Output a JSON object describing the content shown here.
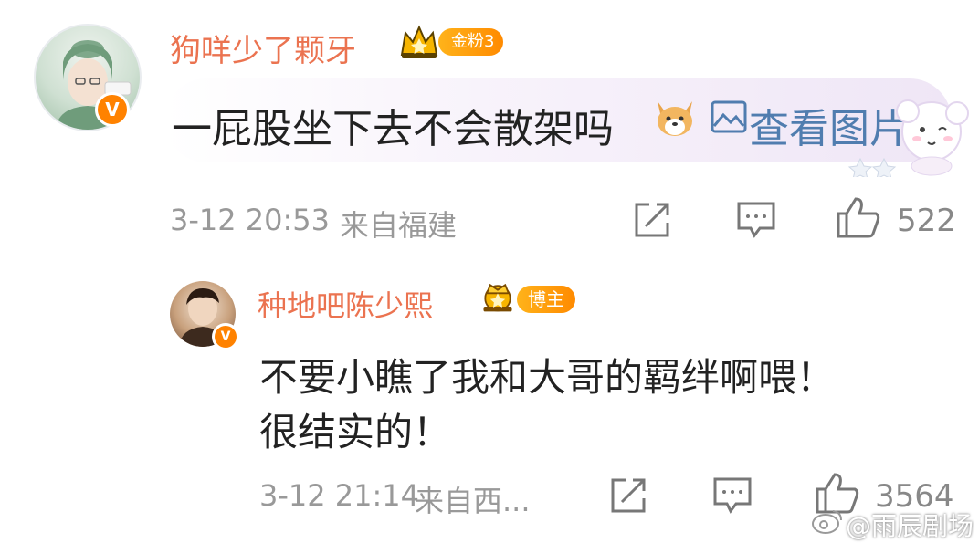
{
  "comment": {
    "username": "狗咩少了颗牙",
    "fan_badge": "金粉3",
    "text": "一屁股坐下去不会散架吗",
    "view_image_label": "查看图片",
    "timestamp": "3-12 20:53",
    "location": "来自福建",
    "like_count": "522"
  },
  "reply": {
    "username": "种地吧陈少熙",
    "role_badge": "博主",
    "text_line1": "不要小瞧了我和大哥的羁绊啊喂！",
    "text_line2": "很结实的！",
    "timestamp": "3-12 21:14",
    "location": "来自西...",
    "like_count": "3564"
  },
  "watermark": "@雨辰剧场",
  "colors": {
    "username": "#eb7350",
    "link": "#507daf",
    "badge": "#ff8a00",
    "verified": "#ff8200"
  },
  "icons": [
    "verified-icon",
    "crown-icon",
    "dog-emoji-icon",
    "image-icon",
    "share-icon",
    "comment-icon",
    "like-icon",
    "bear-sticker-icon",
    "weibo-logo-icon"
  ]
}
